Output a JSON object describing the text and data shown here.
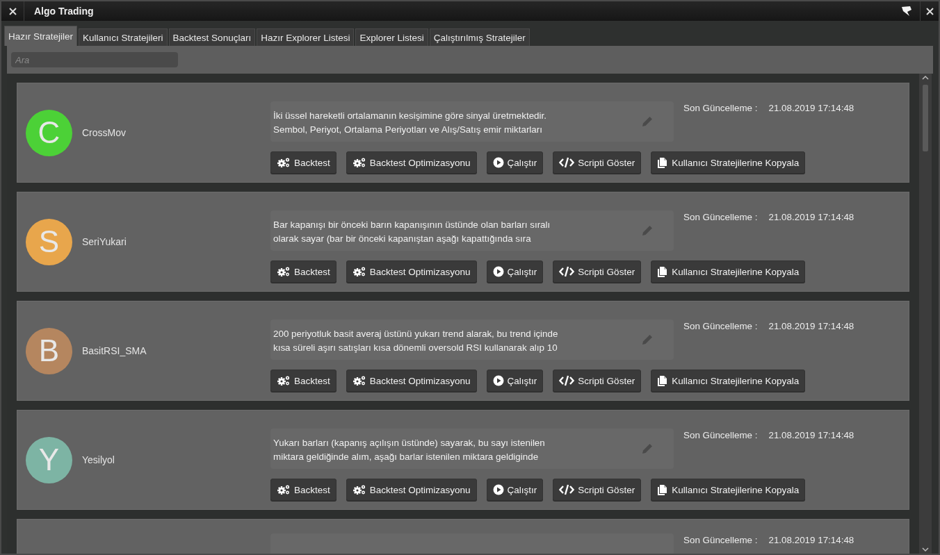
{
  "window": {
    "title": "Algo Trading"
  },
  "tabs": [
    {
      "label": "Hazır Stratejiler",
      "selected": true
    },
    {
      "label": "Kullanıcı Stratejileri",
      "selected": false
    },
    {
      "label": "Backtest Sonuçları",
      "selected": false
    },
    {
      "label": "Hazır Explorer Listesi",
      "selected": false
    },
    {
      "label": "Explorer Listesi",
      "selected": false
    },
    {
      "label": "Çalıştırılmış Stratejiler",
      "selected": false
    }
  ],
  "search": {
    "placeholder": "Ara"
  },
  "strategies": [
    {
      "initial": "C",
      "name": "CrossMov",
      "color": "#4cd137",
      "description_lines": [
        "İki üssel hareketli ortalamanın kesişimine göre sinyal üretmektedir.",
        "Sembol, Periyot, Ortalama Periyotları ve Alış/Satış emir miktarları"
      ],
      "updated_label": "Son Güncelleme :",
      "updated": "21.08.2019 17:14:48",
      "buttons": [
        {
          "kind": "gears",
          "label": "Backtest"
        },
        {
          "kind": "gears",
          "label": "Backtest Optimizasyonu"
        },
        {
          "kind": "play",
          "label": "Çalıştır"
        },
        {
          "kind": "code",
          "label": "Scripti Göster"
        },
        {
          "kind": "copy",
          "label": "Kullanıcı Stratejilerine Kopyala"
        }
      ]
    },
    {
      "initial": "S",
      "name": "SeriYukari",
      "color": "#e8a64c",
      "description_lines": [
        "Bar kapanışı bir önceki barın kapanışının üstünde olan barları sıralı",
        "olarak sayar (bar bir önceki kapanıştan aşağı kapattığında sıra"
      ],
      "updated_label": "Son Güncelleme :",
      "updated": "21.08.2019 17:14:48",
      "buttons": [
        {
          "kind": "gears",
          "label": "Backtest"
        },
        {
          "kind": "gears",
          "label": "Backtest Optimizasyonu"
        },
        {
          "kind": "play",
          "label": "Çalıştır"
        },
        {
          "kind": "code",
          "label": "Scripti Göster"
        },
        {
          "kind": "copy",
          "label": "Kullanıcı Stratejilerine Kopyala"
        }
      ]
    },
    {
      "initial": "B",
      "name": "BasitRSI_SMA",
      "color": "#b5865f",
      "description_lines": [
        "200 periyotluk basit averaj üstünü yukarı trend alarak, bu trend içinde",
        "kısa süreli aşırı satışları kısa dönemli oversold RSI kullanarak alıp 10"
      ],
      "updated_label": "Son Güncelleme :",
      "updated": "21.08.2019 17:14:48",
      "buttons": [
        {
          "kind": "gears",
          "label": "Backtest"
        },
        {
          "kind": "gears",
          "label": "Backtest Optimizasyonu"
        },
        {
          "kind": "play",
          "label": "Çalıştır"
        },
        {
          "kind": "code",
          "label": "Scripti Göster"
        },
        {
          "kind": "copy",
          "label": "Kullanıcı Stratejilerine Kopyala"
        }
      ]
    },
    {
      "initial": "Y",
      "name": "Yesilyol",
      "color": "#7db4a4",
      "description_lines": [
        "Yukarı barları (kapanış açılışın üstünde) sayarak, bu sayı istenilen",
        "miktara geldiğinde alım, aşağı barlar istenilen miktara geldiginde"
      ],
      "updated_label": "Son Güncelleme :",
      "updated": "21.08.2019 17:14:48",
      "buttons": [
        {
          "kind": "gears",
          "label": "Backtest"
        },
        {
          "kind": "gears",
          "label": "Backtest Optimizasyonu"
        },
        {
          "kind": "play",
          "label": "Çalıştır"
        },
        {
          "kind": "code",
          "label": "Scripti Göster"
        },
        {
          "kind": "copy",
          "label": "Kullanıcı Stratejilerine Kopyala"
        }
      ]
    },
    {
      "updated_label": "Son Güncelleme :",
      "updated": "21.08.2019 17:14:48"
    }
  ]
}
